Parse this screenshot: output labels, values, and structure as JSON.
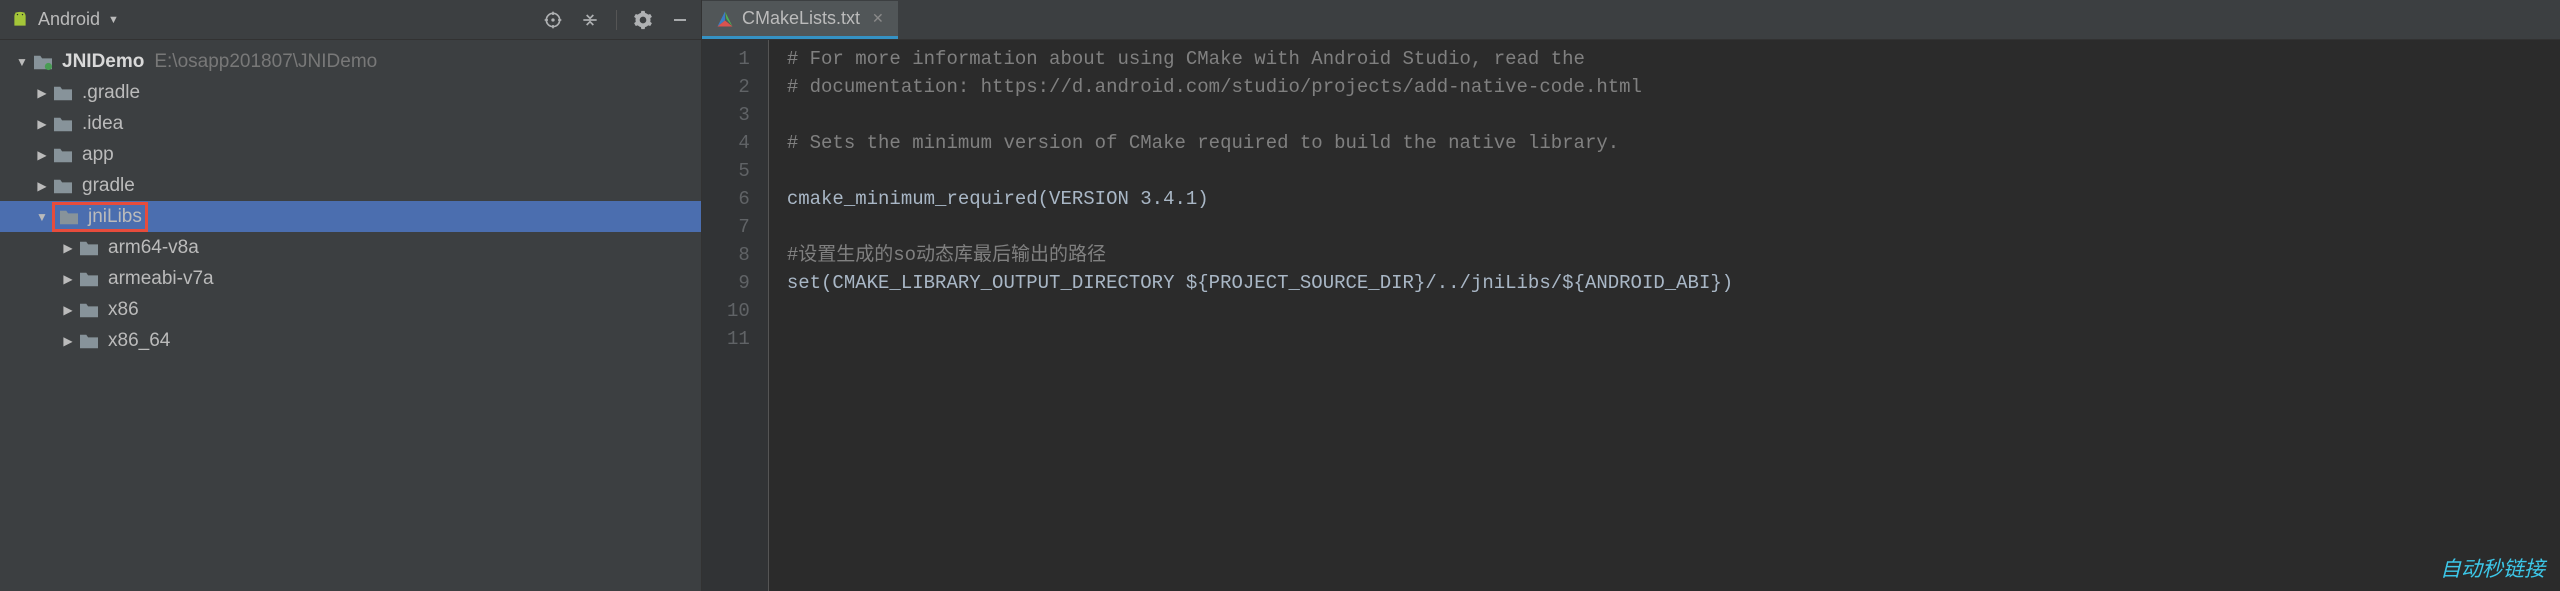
{
  "toolbar": {
    "title": "Android"
  },
  "project": {
    "name": "JNIDemo",
    "path": "E:\\osapp201807\\JNIDemo",
    "children": [
      {
        "label": ".gradle",
        "expanded": false
      },
      {
        "label": ".idea",
        "expanded": false
      },
      {
        "label": "app",
        "expanded": false
      },
      {
        "label": "gradle",
        "expanded": false
      },
      {
        "label": "jniLibs",
        "expanded": true,
        "highlighted": true,
        "selected": true,
        "children": [
          {
            "label": "arm64-v8a",
            "expanded": false
          },
          {
            "label": "armeabi-v7a",
            "expanded": false
          },
          {
            "label": "x86",
            "expanded": false
          },
          {
            "label": "x86_64",
            "expanded": false
          }
        ]
      }
    ]
  },
  "editor": {
    "tab": {
      "label": "CMakeLists.txt"
    },
    "lines": [
      "# For more information about using CMake with Android Studio, read the",
      "# documentation: https://d.android.com/studio/projects/add-native-code.html",
      "",
      "# Sets the minimum version of CMake required to build the native library.",
      "",
      "cmake_minimum_required(VERSION 3.4.1)",
      "",
      "#设置生成的so动态库最后输出的路径",
      "set(CMAKE_LIBRARY_OUTPUT_DIRECTORY ${PROJECT_SOURCE_DIR}/../jniLibs/${ANDROID_ABI})",
      "",
      ""
    ]
  },
  "watermark": "自动秒链接"
}
